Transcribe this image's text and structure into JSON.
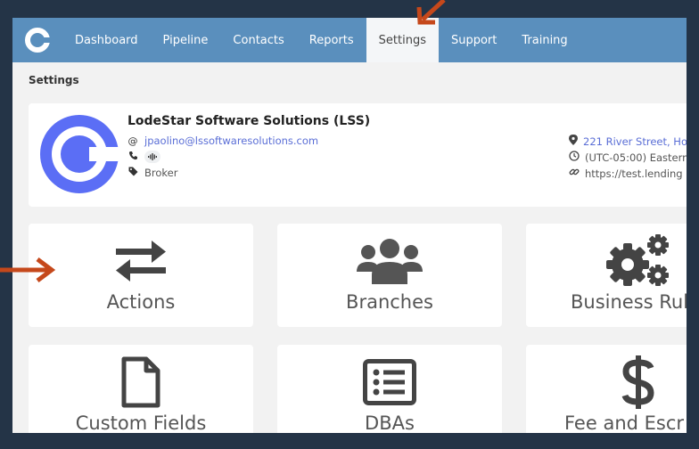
{
  "nav": {
    "items": [
      {
        "label": "Dashboard"
      },
      {
        "label": "Pipeline"
      },
      {
        "label": "Contacts"
      },
      {
        "label": "Reports"
      },
      {
        "label": "Settings",
        "active": true
      },
      {
        "label": "Support"
      },
      {
        "label": "Training"
      }
    ]
  },
  "breadcrumb": "Settings",
  "profile": {
    "name": "LodeStar Software Solutions (LSS)",
    "email": "jpaolino@lssoftwaresolutions.com",
    "role": "Broker",
    "address": "221 River Street, Hob",
    "timezone": "(UTC-05:00) Eastern",
    "website": "https://test.lending"
  },
  "tiles": [
    {
      "label": "Actions",
      "icon": "swap-arrows-icon"
    },
    {
      "label": "Branches",
      "icon": "users-group-icon"
    },
    {
      "label": "Business Rul",
      "icon": "gears-icon"
    },
    {
      "label": "Custom Fields",
      "icon": "document-icon"
    },
    {
      "label": "DBAs",
      "icon": "list-icon"
    },
    {
      "label": "Fee and Escr",
      "icon": "dollar-icon"
    }
  ],
  "colors": {
    "nav_bg": "#5a8fbd",
    "accent": "#5b6ef5",
    "annotation": "#c5481b",
    "frame_border": "#243447"
  }
}
